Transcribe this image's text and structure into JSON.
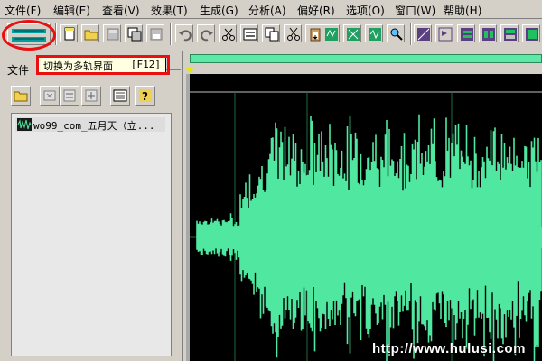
{
  "menu": {
    "items": [
      "文件(F)",
      "编辑(E)",
      "查看(V)",
      "效果(T)",
      "生成(G)",
      "分析(A)",
      "偏好(R)",
      "选项(O)",
      "窗口(W)",
      "帮助(H)"
    ]
  },
  "toolbar": {
    "buttons": [
      "multitrack-switch",
      "new",
      "open",
      "save",
      "save-as",
      "save-all",
      "undo",
      "redo",
      "cut-edge",
      "copy-new",
      "copy",
      "cut",
      "paste",
      "mix-paste",
      "trim",
      "crop",
      "play-to",
      "zoom",
      "snap",
      "marker",
      "track-a",
      "track-b",
      "track-c"
    ]
  },
  "left_panel": {
    "tab_label": "文件",
    "file_item": "wo99_com_五月天（立..."
  },
  "tooltip": {
    "text": "切换为多轨界面",
    "shortcut": "[F12]"
  },
  "watermark": "http://www.hulusi.com",
  "colors": {
    "waveform": "#50e8a0",
    "background": "#000000",
    "grid": "#1d6b3e",
    "annotation": "#e81010",
    "panel": "#d4d0c8"
  }
}
